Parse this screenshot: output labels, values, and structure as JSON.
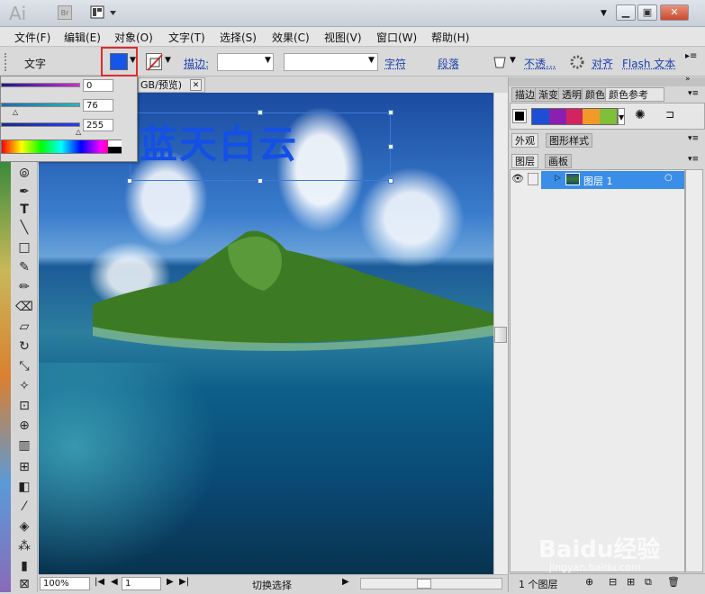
{
  "app": {
    "logo": "Ai",
    "bridge_logo": "Br"
  },
  "menu": [
    "文件(F)",
    "编辑(E)",
    "对象(O)",
    "文字(T)",
    "选择(S)",
    "效果(C)",
    "视图(V)",
    "窗口(W)",
    "帮助(H)"
  ],
  "control": {
    "selection_label": "文字",
    "fill_color": "#1456e8",
    "stroke_label": "描边:",
    "character_label": "字符",
    "paragraph_label": "段落",
    "opacity_label": "不透...",
    "align_label": "对齐",
    "flash_label": "Flash 文本"
  },
  "color_popup": {
    "sliders": [
      {
        "value": "0",
        "color": "#cf2bd3"
      },
      {
        "value": "76",
        "color": "#26b6b9"
      },
      {
        "value": "255",
        "color": "#2a3cf0"
      }
    ]
  },
  "document": {
    "tab_title": "GB/预览)",
    "headline": "蓝天白云",
    "headline_color": "#1450e6"
  },
  "status": {
    "zoom": "100%",
    "page": "1",
    "mode": "切换选择"
  },
  "panels": {
    "top_tabs": [
      "描边",
      "渐变",
      "透明",
      "颜色",
      "颜色参考"
    ],
    "mid_tabs": [
      "外观",
      "图形样式"
    ],
    "layer_tabs": [
      "图层",
      "画板"
    ],
    "swatch_colors": [
      "#1d4fd6",
      "#8b1fb0",
      "#d2255f",
      "#f29a28",
      "#7fbf3a"
    ],
    "layer_name": "图层 1",
    "layer_count": "1 个图层"
  },
  "watermark": {
    "brand": "Baidu经验",
    "url": "jingyan.baidu.com"
  }
}
